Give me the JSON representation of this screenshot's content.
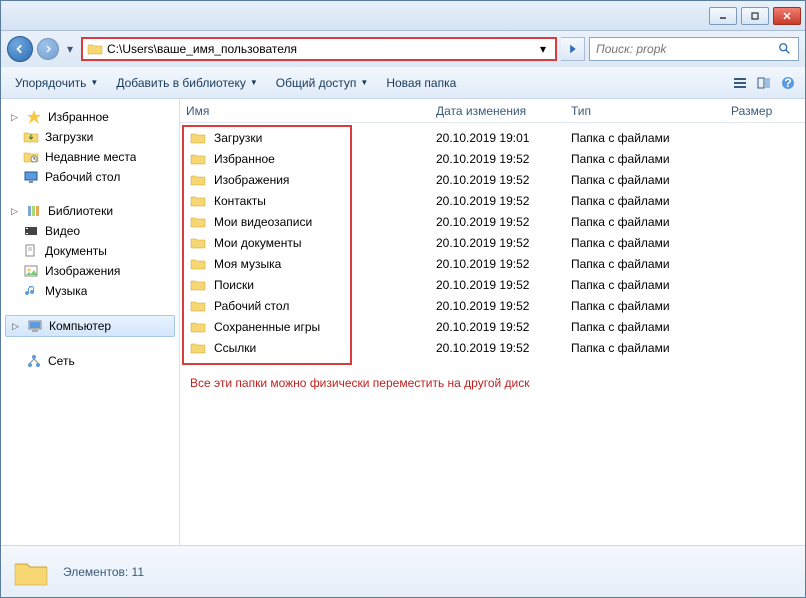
{
  "address": "C:\\Users\\ваше_имя_пользователя",
  "search": {
    "placeholder": "Поиск: propk"
  },
  "toolbar": {
    "organize": "Упорядочить",
    "include": "Добавить в библиотеку",
    "share": "Общий доступ",
    "newfolder": "Новая папка"
  },
  "sidebar": {
    "favorites": {
      "title": "Избранное",
      "items": [
        "Загрузки",
        "Недавние места",
        "Рабочий стол"
      ]
    },
    "libraries": {
      "title": "Библиотеки",
      "items": [
        "Видео",
        "Документы",
        "Изображения",
        "Музыка"
      ]
    },
    "computer": "Компьютер",
    "network": "Сеть"
  },
  "columns": {
    "name": "Имя",
    "date": "Дата изменения",
    "type": "Тип",
    "size": "Размер"
  },
  "files": [
    {
      "name": "Загрузки",
      "date": "20.10.2019 19:01",
      "type": "Папка с файлами"
    },
    {
      "name": "Избранное",
      "date": "20.10.2019 19:52",
      "type": "Папка с файлами"
    },
    {
      "name": "Изображения",
      "date": "20.10.2019 19:52",
      "type": "Папка с файлами"
    },
    {
      "name": "Контакты",
      "date": "20.10.2019 19:52",
      "type": "Папка с файлами"
    },
    {
      "name": "Мои видеозаписи",
      "date": "20.10.2019 19:52",
      "type": "Папка с файлами"
    },
    {
      "name": "Мои документы",
      "date": "20.10.2019 19:52",
      "type": "Папка с файлами"
    },
    {
      "name": "Моя музыка",
      "date": "20.10.2019 19:52",
      "type": "Папка с файлами"
    },
    {
      "name": "Поиски",
      "date": "20.10.2019 19:52",
      "type": "Папка с файлами"
    },
    {
      "name": "Рабочий стол",
      "date": "20.10.2019 19:52",
      "type": "Папка с файлами"
    },
    {
      "name": "Сохраненные игры",
      "date": "20.10.2019 19:52",
      "type": "Папка с файлами"
    },
    {
      "name": "Ссылки",
      "date": "20.10.2019 19:52",
      "type": "Папка с файлами"
    }
  ],
  "annotation": "Все эти папки можно физически переместить на другой диск",
  "status": {
    "label": "Элементов:",
    "count": "11"
  }
}
